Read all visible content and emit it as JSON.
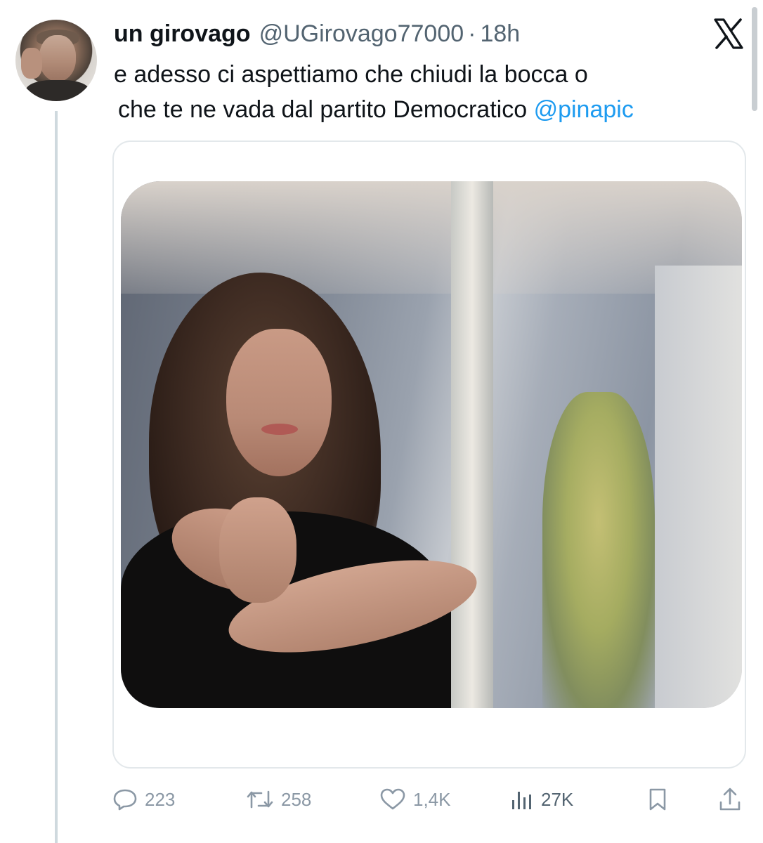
{
  "author": {
    "display_name": "un girovago",
    "handle": "@UGirovago77000",
    "separator": "·",
    "time": "18h"
  },
  "platform_logo": "x-logo-icon",
  "tweet": {
    "line1": "e adesso ci aspettiamo che chiudi la bocca o",
    "line2_text": "che te ne vada dal partito Democratico",
    "line2_mention": "@pinapic"
  },
  "media": {
    "icon": "photo-attachment"
  },
  "actions": {
    "reply": {
      "icon": "reply-icon",
      "count": "223"
    },
    "retweet": {
      "icon": "retweet-icon",
      "count": "258"
    },
    "like": {
      "icon": "heart-icon",
      "count": "1,4K"
    },
    "views": {
      "icon": "views-chart-icon",
      "count": "27K"
    },
    "bookmark": {
      "icon": "bookmark-icon"
    },
    "share": {
      "icon": "share-icon"
    }
  },
  "colors": {
    "text": "#0f1419",
    "secondary": "#536471",
    "mention": "#1d9bf0",
    "action_muted": "#8b98a5",
    "border": "#e3e8eb"
  }
}
